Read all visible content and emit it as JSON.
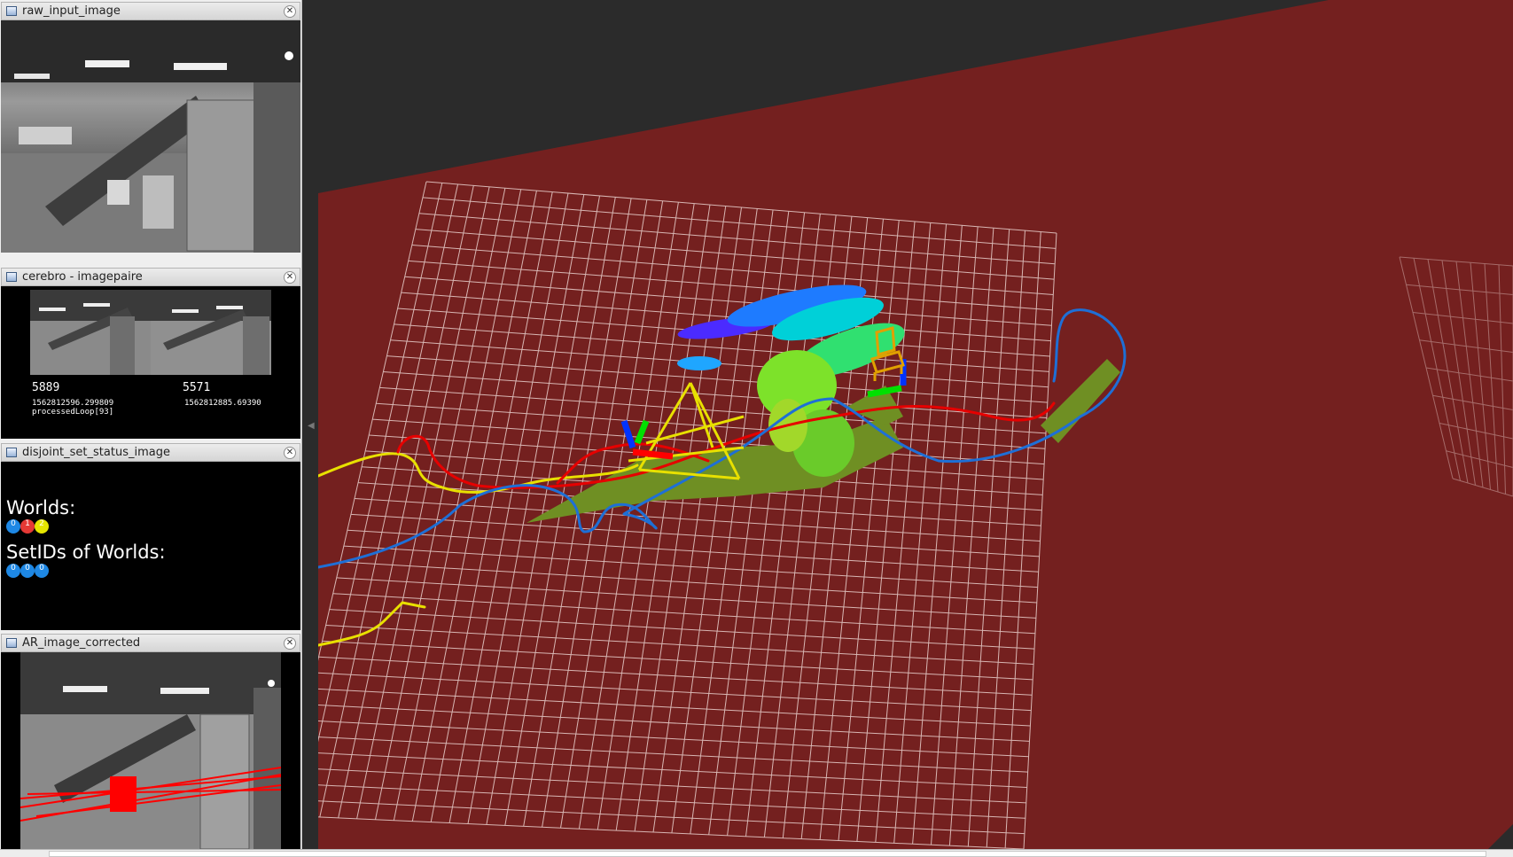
{
  "panels": {
    "raw": {
      "title": "raw_input_image"
    },
    "cerebro": {
      "title": "cerebro - imagepaire",
      "left_frame_id": "5889",
      "right_frame_id": "5571",
      "left_timestamp": "1562812596.299809",
      "right_timestamp": "1562812885.69390",
      "status": "processedLoop[93]"
    },
    "disjoint": {
      "title": "disjoint_set_status_image",
      "worlds_label": "Worlds:",
      "world_dots": [
        {
          "label": "0",
          "color": "#1e88e5"
        },
        {
          "label": "1",
          "color": "#e53935"
        },
        {
          "label": "2",
          "color": "#e6e600"
        }
      ],
      "setids_label": "SetIDs of Worlds:",
      "setid_dots": [
        {
          "label": "0",
          "color": "#1e88e5"
        },
        {
          "label": "0",
          "color": "#1e88e5"
        },
        {
          "label": "0",
          "color": "#1e88e5"
        }
      ]
    },
    "ar": {
      "title": "AR_image_corrected"
    }
  },
  "icons": {
    "panel": "image-window-icon",
    "close": "close-icon",
    "handle": "dock-collapse-arrow-icon"
  },
  "colors": {
    "ground": "#74201f",
    "grid": "#d8b6b3",
    "background": "#2b2b2b",
    "traj_yellow": "#e8e000",
    "traj_red": "#e60000",
    "traj_blue": "#1e6fd6",
    "pointcloud_olive": "#6f8f23"
  },
  "close_glyph": "✕",
  "handle_glyph": "◀"
}
